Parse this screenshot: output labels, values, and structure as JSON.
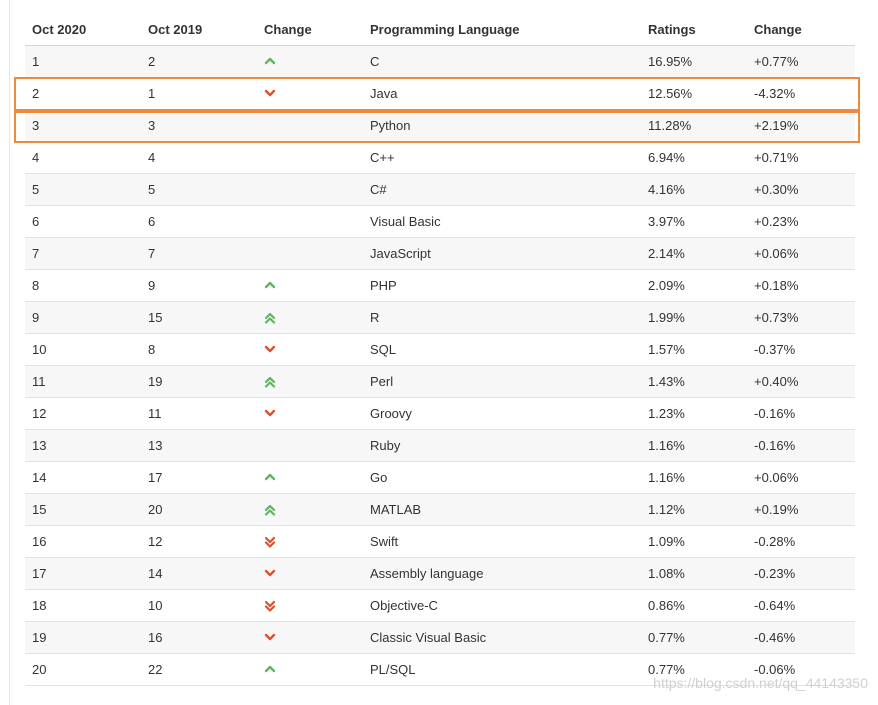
{
  "header": {
    "col_oct2020": "Oct 2020",
    "col_oct2019": "Oct 2019",
    "col_change": "Change",
    "col_language": "Programming Language",
    "col_ratings": "Ratings",
    "col_delta": "Change"
  },
  "colors": {
    "up": "#5cb85c",
    "down": "#e0502a",
    "highlight": "#f0883e"
  },
  "rows": [
    {
      "oct2020": "1",
      "oct2019": "2",
      "trend": "up",
      "language": "C",
      "rating": "16.95%",
      "delta": "+0.77%"
    },
    {
      "oct2020": "2",
      "oct2019": "1",
      "trend": "down",
      "language": "Java",
      "rating": "12.56%",
      "delta": "-4.32%"
    },
    {
      "oct2020": "3",
      "oct2019": "3",
      "trend": "none",
      "language": "Python",
      "rating": "11.28%",
      "delta": "+2.19%"
    },
    {
      "oct2020": "4",
      "oct2019": "4",
      "trend": "none",
      "language": "C++",
      "rating": "6.94%",
      "delta": "+0.71%"
    },
    {
      "oct2020": "5",
      "oct2019": "5",
      "trend": "none",
      "language": "C#",
      "rating": "4.16%",
      "delta": "+0.30%"
    },
    {
      "oct2020": "6",
      "oct2019": "6",
      "trend": "none",
      "language": "Visual Basic",
      "rating": "3.97%",
      "delta": "+0.23%"
    },
    {
      "oct2020": "7",
      "oct2019": "7",
      "trend": "none",
      "language": "JavaScript",
      "rating": "2.14%",
      "delta": "+0.06%"
    },
    {
      "oct2020": "8",
      "oct2019": "9",
      "trend": "up",
      "language": "PHP",
      "rating": "2.09%",
      "delta": "+0.18%"
    },
    {
      "oct2020": "9",
      "oct2019": "15",
      "trend": "up2",
      "language": "R",
      "rating": "1.99%",
      "delta": "+0.73%"
    },
    {
      "oct2020": "10",
      "oct2019": "8",
      "trend": "down",
      "language": "SQL",
      "rating": "1.57%",
      "delta": "-0.37%"
    },
    {
      "oct2020": "11",
      "oct2019": "19",
      "trend": "up2",
      "language": "Perl",
      "rating": "1.43%",
      "delta": "+0.40%"
    },
    {
      "oct2020": "12",
      "oct2019": "11",
      "trend": "down",
      "language": "Groovy",
      "rating": "1.23%",
      "delta": "-0.16%"
    },
    {
      "oct2020": "13",
      "oct2019": "13",
      "trend": "none",
      "language": "Ruby",
      "rating": "1.16%",
      "delta": "-0.16%"
    },
    {
      "oct2020": "14",
      "oct2019": "17",
      "trend": "up",
      "language": "Go",
      "rating": "1.16%",
      "delta": "+0.06%"
    },
    {
      "oct2020": "15",
      "oct2019": "20",
      "trend": "up2",
      "language": "MATLAB",
      "rating": "1.12%",
      "delta": "+0.19%"
    },
    {
      "oct2020": "16",
      "oct2019": "12",
      "trend": "down2",
      "language": "Swift",
      "rating": "1.09%",
      "delta": "-0.28%"
    },
    {
      "oct2020": "17",
      "oct2019": "14",
      "trend": "down",
      "language": "Assembly language",
      "rating": "1.08%",
      "delta": "-0.23%"
    },
    {
      "oct2020": "18",
      "oct2019": "10",
      "trend": "down2",
      "language": "Objective-C",
      "rating": "0.86%",
      "delta": "-0.64%"
    },
    {
      "oct2020": "19",
      "oct2019": "16",
      "trend": "down",
      "language": "Classic Visual Basic",
      "rating": "0.77%",
      "delta": "-0.46%"
    },
    {
      "oct2020": "20",
      "oct2019": "22",
      "trend": "up",
      "language": "PL/SQL",
      "rating": "0.77%",
      "delta": "-0.06%"
    }
  ],
  "highlighted_rows": [
    "Java",
    "Python"
  ],
  "watermark": "https://blog.csdn.net/qq_44143350"
}
